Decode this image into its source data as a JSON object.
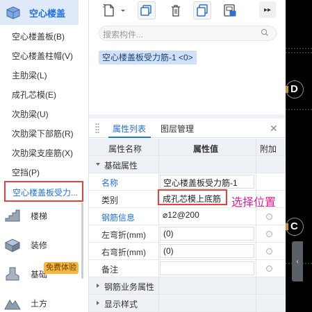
{
  "sidebar": {
    "category": "空心楼盖",
    "items": [
      {
        "label": "空心楼盖板(B)"
      },
      {
        "label": "空心楼盖柱帽(V)"
      },
      {
        "label": "主肋梁(L)"
      },
      {
        "label": "成孔芯模(E)"
      },
      {
        "label": "次肋梁(U)"
      },
      {
        "label": "次肋梁下部筋(R)"
      },
      {
        "label": "次肋梁支座筋(X)"
      },
      {
        "label": "空挡(P)"
      },
      {
        "label": "空心楼盖板受力..."
      }
    ],
    "categories": [
      {
        "label": "楼梯",
        "icon": "stairs-icon"
      },
      {
        "label": "装修",
        "icon": "decoration-icon"
      },
      {
        "label": "基础",
        "icon": "foundation-icon"
      },
      {
        "label": "土方",
        "icon": "earthwork-icon"
      }
    ],
    "free_badge": "免费体验"
  },
  "toolbar": {
    "icons": [
      "new-icon",
      "copy-icon",
      "delete-icon",
      "duplicate-icon",
      "layer-copy-icon",
      "more-icon"
    ]
  },
  "search": {
    "placeholder": "搜索构件..."
  },
  "component_tag": "空心楼盖板受力筋-1 <0>",
  "props_panel": {
    "tabs": [
      "属性列表",
      "图层管理"
    ],
    "active_tab": "属性列表",
    "headers": {
      "name": "属性名称",
      "value": "属性值",
      "extra": "附加"
    },
    "sections": {
      "basic": "基础属性",
      "rebar_business": "钢筋业务属性",
      "display": "显示样式"
    },
    "rows": [
      {
        "name": "名称",
        "value": "空心楼盖板受力筋-1",
        "link": true,
        "radio": false
      },
      {
        "name": "类别",
        "value": "成孔芯模上底筋",
        "link": false,
        "radio": false
      },
      {
        "name": "钢筋信息",
        "value": "⌀12@200",
        "link": true,
        "radio": true
      },
      {
        "name": "左弯折(mm)",
        "value": "(0)",
        "link": false,
        "radio": true
      },
      {
        "name": "右弯折(mm)",
        "value": "(0)",
        "link": false,
        "radio": true
      },
      {
        "name": "备注",
        "value": "",
        "link": false,
        "radio": true
      }
    ]
  },
  "annotation": "选择位置",
  "canvas": {
    "axis_labels": [
      "D",
      "C"
    ],
    "colors": {
      "background": "#000000",
      "grid_line": "#3a7a3a",
      "circle": "#8a8a8a"
    }
  },
  "colors": {
    "accent": "#1f6fdc",
    "highlight": "#e8413d",
    "annotation": "#e3208f"
  }
}
